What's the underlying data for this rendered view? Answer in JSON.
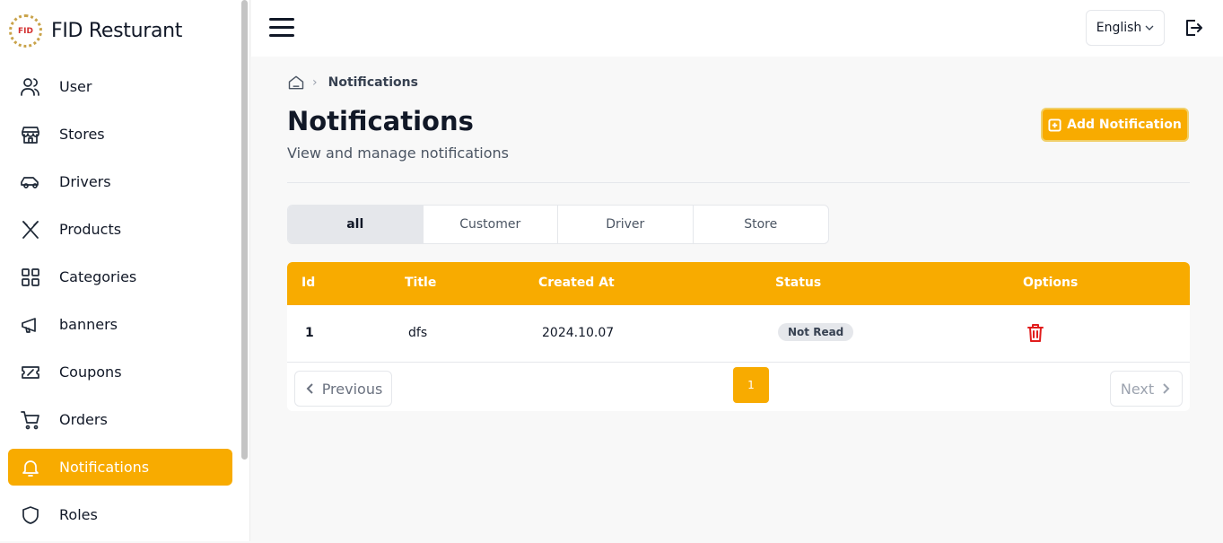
{
  "brand": {
    "logo_text": "FID",
    "name": "FID Resturant"
  },
  "sidebar": {
    "items": [
      {
        "label": "User",
        "icon": "users-icon",
        "active": false
      },
      {
        "label": "Stores",
        "icon": "store-icon",
        "active": false
      },
      {
        "label": "Drivers",
        "icon": "car-icon",
        "active": false
      },
      {
        "label": "Products",
        "icon": "utensils-icon",
        "active": false
      },
      {
        "label": "Categories",
        "icon": "grid-icon",
        "active": false
      },
      {
        "label": "banners",
        "icon": "megaphone-icon",
        "active": false
      },
      {
        "label": "Coupons",
        "icon": "ticket-icon",
        "active": false
      },
      {
        "label": "Orders",
        "icon": "cart-icon",
        "active": false
      },
      {
        "label": "Notifications",
        "icon": "bell-icon",
        "active": true
      },
      {
        "label": "Roles",
        "icon": "shield-icon",
        "active": false
      }
    ]
  },
  "topbar": {
    "language": "English"
  },
  "breadcrumb": {
    "current": "Notifications"
  },
  "page": {
    "title": "Notifications",
    "subtitle": "View and manage notifications",
    "add_button": "Add Notification"
  },
  "tabs": [
    {
      "label": "all",
      "active": true
    },
    {
      "label": "Customer",
      "active": false
    },
    {
      "label": "Driver",
      "active": false
    },
    {
      "label": "Store",
      "active": false
    }
  ],
  "table": {
    "headers": [
      "Id",
      "Title",
      "Created At",
      "Status",
      "Options"
    ],
    "rows": [
      {
        "id": "1",
        "title": "dfs",
        "created_at": "2024.10.07",
        "status": "Not Read"
      }
    ]
  },
  "pagination": {
    "previous": "Previous",
    "current_page": "1",
    "next": "Next"
  },
  "colors": {
    "accent": "#f8ab00",
    "danger": "#e11d1d",
    "text": "#111827"
  }
}
